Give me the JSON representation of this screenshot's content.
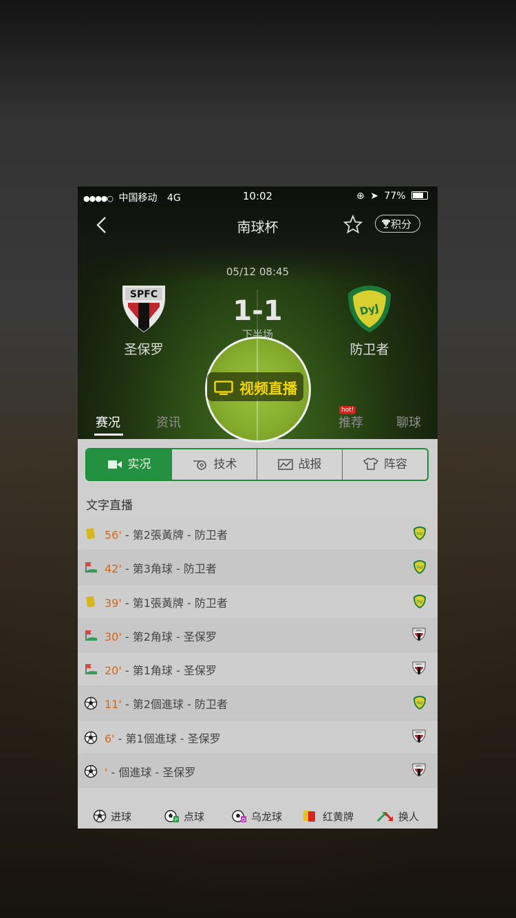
{
  "status_bar": {
    "carrier": "中国移动",
    "network": "4G",
    "time": "10:02",
    "battery": "77%"
  },
  "header": {
    "title": "南球杯",
    "points_label": "积分"
  },
  "match": {
    "datetime": "05/12 08:45",
    "score": "1-1",
    "period": "下半场",
    "home": {
      "name": "圣保罗",
      "crest_text": "SPFC"
    },
    "away": {
      "name": "防卫者",
      "crest_text": "DyJ"
    },
    "live_button": "视频直播"
  },
  "tabs": [
    {
      "label": "赛况"
    },
    {
      "label": "资讯"
    },
    {
      "label": ""
    },
    {
      "label": ""
    },
    {
      "label": "推荐",
      "badge": "hot!"
    },
    {
      "label": "聊球"
    }
  ],
  "subtabs": [
    {
      "label": "实况"
    },
    {
      "label": "技术"
    },
    {
      "label": "战报"
    },
    {
      "label": "阵容"
    }
  ],
  "section_title": "文字直播",
  "events": [
    {
      "icon": "yellow-card",
      "minute": "56'",
      "text": " - 第2張黃牌 - 防卫者",
      "team": "away"
    },
    {
      "icon": "corner-flag",
      "minute": "42'",
      "text": " - 第3角球 - 防卫者",
      "team": "away"
    },
    {
      "icon": "yellow-card",
      "minute": "39'",
      "text": " - 第1張黃牌 - 防卫者",
      "team": "away"
    },
    {
      "icon": "corner-flag",
      "minute": "30'",
      "text": " - 第2角球 - 圣保罗",
      "team": "home"
    },
    {
      "icon": "corner-flag",
      "minute": "20'",
      "text": " - 第1角球 - 圣保罗",
      "team": "home"
    },
    {
      "icon": "soccer-ball",
      "minute": "11'",
      "text": " - 第2個進球 - 防卫者",
      "team": "away"
    },
    {
      "icon": "soccer-ball",
      "minute": "6'",
      "text": " - 第1個進球 - 圣保罗",
      "team": "home"
    },
    {
      "icon": "soccer-ball",
      "minute": "'",
      "text": " - 個進球 - 圣保罗",
      "team": "home"
    }
  ],
  "legend": [
    {
      "icon": "soccer-ball",
      "label": "进球"
    },
    {
      "icon": "penalty",
      "label": "点球"
    },
    {
      "icon": "own-goal",
      "label": "乌龙球"
    },
    {
      "icon": "red-yellow-card",
      "label": "红黄牌"
    },
    {
      "icon": "substitution",
      "label": "换人"
    }
  ],
  "colors": {
    "accent_green": "#23913f",
    "live_yellow": "#f2d400",
    "minute_orange": "#d0671a"
  }
}
